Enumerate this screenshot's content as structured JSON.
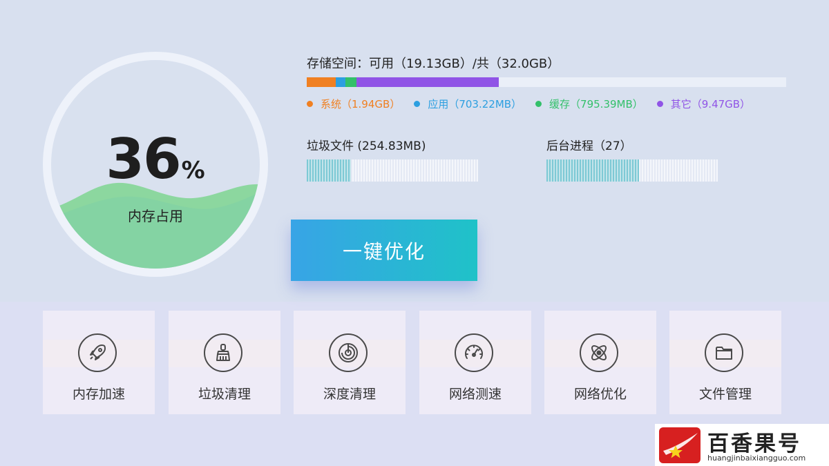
{
  "memory": {
    "value": "36",
    "unit": "%",
    "label": "内存占用",
    "percent": 36
  },
  "storage": {
    "title": "存储空间：可用（19.13GB）/共（32.0GB）",
    "segments": [
      {
        "label": "系统（1.94GB）",
        "color": "#f08022",
        "fraction": 0.06
      },
      {
        "label": "应用（703.22MB）",
        "color": "#2c9fe0",
        "fraction": 0.02
      },
      {
        "label": "缓存（795.39MB）",
        "color": "#33c06a",
        "fraction": 0.024
      },
      {
        "label": "其它（9.47GB）",
        "color": "#9054e6",
        "fraction": 0.296
      }
    ]
  },
  "junk": {
    "label": "垃圾文件 (254.83MB)",
    "fill": 0.26
  },
  "process": {
    "label": "后台进程（27）",
    "fill": 0.54
  },
  "optimize_button": "一键优化",
  "tools": [
    {
      "label": "内存加速",
      "icon": "rocket-icon"
    },
    {
      "label": "垃圾清理",
      "icon": "broom-icon"
    },
    {
      "label": "深度清理",
      "icon": "radar-icon"
    },
    {
      "label": "网络测速",
      "icon": "speedometer-icon"
    },
    {
      "label": "网络优化",
      "icon": "atom-icon"
    },
    {
      "label": "文件管理",
      "icon": "folder-icon"
    }
  ],
  "watermark": {
    "name": "百香果号",
    "url": "huangjinbaixiangguo.com"
  }
}
